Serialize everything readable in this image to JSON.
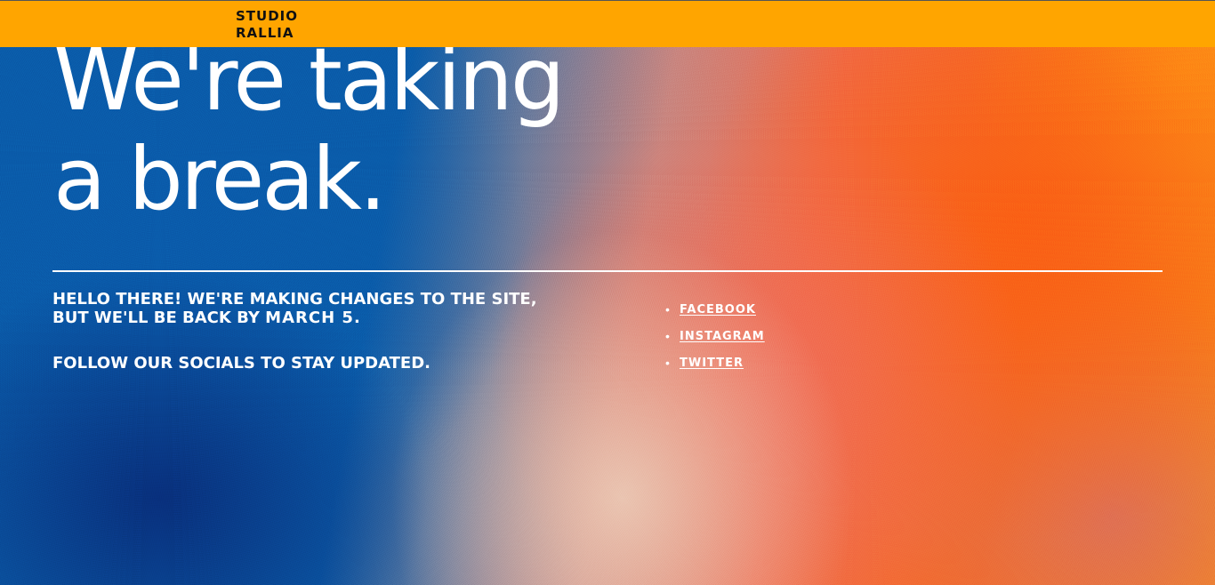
{
  "header": {
    "logo_line1": "STUDIO",
    "logo_line2": "RALLIA",
    "bar_color": "#ffa500"
  },
  "hero": {
    "headline_line1": "We're taking",
    "headline_line2": "a break."
  },
  "message": {
    "line1": "HELLO THERE! WE'RE MAKING CHANGES TO THE SITE,",
    "line2_prefix": "BUT WE'LL BE BACK BY ",
    "line2_date": "MARCH 5",
    "line2_suffix": ".",
    "follow": "FOLLOW OUR SOCIALS TO STAY UPDATED."
  },
  "socials": {
    "bullet": "•",
    "items": [
      {
        "label": "FACEBOOK"
      },
      {
        "label": "INSTAGRAM"
      },
      {
        "label": "TWITTER"
      }
    ]
  },
  "colors": {
    "blue": "#0a5ba8",
    "orange": "#f56a22",
    "text": "#ffffff"
  }
}
